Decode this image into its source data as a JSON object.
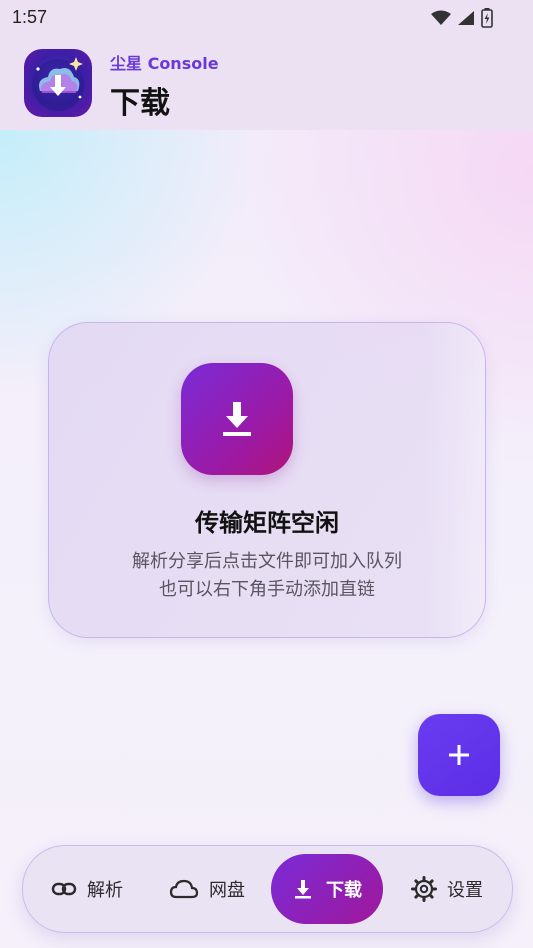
{
  "status_bar": {
    "time": "1:57",
    "icons": [
      "wifi-icon",
      "signal-icon",
      "battery-charging-icon"
    ]
  },
  "header": {
    "subtitle": "尘星 Console",
    "title": "下载",
    "logo_icon": "cloud-download-logo"
  },
  "empty_state": {
    "icon": "download-icon",
    "title": "传输矩阵空闲",
    "line1": "解析分享后点击文件即可加入队列",
    "line2": "也可以右下角手动添加直链"
  },
  "fab": {
    "icon": "plus-icon",
    "label": "+"
  },
  "bottom_nav": {
    "items": [
      {
        "label": "解析",
        "icon": "link-icon",
        "active": false
      },
      {
        "label": "网盘",
        "icon": "cloud-icon",
        "active": false
      },
      {
        "label": "下载",
        "icon": "download-icon",
        "active": true
      },
      {
        "label": "设置",
        "icon": "gear-icon",
        "active": false
      }
    ]
  },
  "colors": {
    "accent": "#6a3ad6",
    "gradient_start": "#7a2bd8",
    "gradient_end": "#b0147a",
    "fab": "#5b2ee6"
  }
}
